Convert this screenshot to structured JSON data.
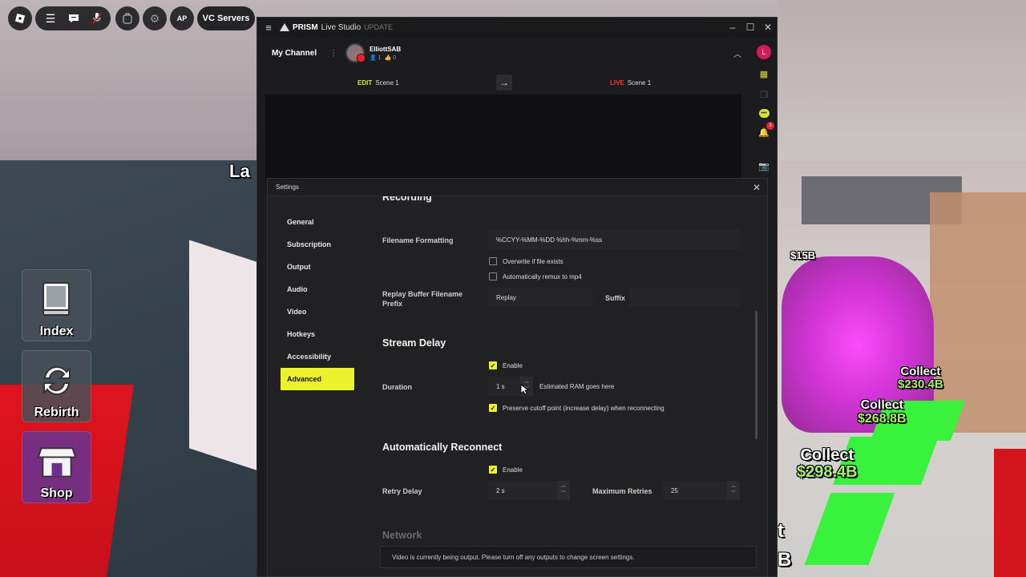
{
  "game": {
    "toolbar": {
      "vc_servers": "VC Servers"
    },
    "side_buttons": {
      "index": "Index",
      "rebirth": "Rebirth",
      "shop": "Shop"
    },
    "world_text": {
      "wall_partial": "La",
      "price_tag": "$15B",
      "collect_1": {
        "label": "Collect",
        "amount": "$230.4B"
      },
      "collect_2": {
        "label": "Collect",
        "amount": "$268.8B"
      },
      "collect_3": {
        "label": "Collect",
        "amount": "$298.4B"
      },
      "edge_t": "t",
      "edge_b": "B"
    }
  },
  "prism": {
    "app_name": "PRISM",
    "app_sub": "Live Studio",
    "update_badge": "UPDATE",
    "my_channel": "My Channel",
    "user": {
      "name": "ElliottSAB",
      "viewers": "1",
      "likes": "0"
    },
    "scene": {
      "edit_tag": "EDIT",
      "edit_scene": "Scene 1",
      "live_tag": "LIVE",
      "live_scene": "Scene 1"
    },
    "profile_initial": "L",
    "notification_count": "3"
  },
  "settings": {
    "title": "Settings",
    "nav": [
      "General",
      "Subscription",
      "Output",
      "Audio",
      "Video",
      "Hotkeys",
      "Accessibility",
      "Advanced"
    ],
    "active_nav": "Advanced",
    "recording": {
      "heading": "Recording",
      "filename_label": "Filename Formatting",
      "filename_value": "%CCYY-%MM-%DD %hh-%mm-%ss",
      "overwrite_label": "Overwrite if file exists",
      "overwrite_checked": false,
      "remux_label": "Automatically remux to mp4",
      "remux_checked": false,
      "replay_label": "Replay Buffer Filename Prefix",
      "replay_value": "Replay",
      "suffix_label": "Suffix",
      "suffix_value": ""
    },
    "stream_delay": {
      "heading": "Stream Delay",
      "enable_label": "Enable",
      "enable_checked": true,
      "duration_label": "Duration",
      "duration_value": "1 s",
      "ram_note": "Estimated RAM goes here",
      "preserve_label": "Preserve cutoff point (increase delay) when reconnecting",
      "preserve_checked": true
    },
    "reconnect": {
      "heading": "Automatically Reconnect",
      "enable_label": "Enable",
      "enable_checked": true,
      "retry_label": "Retry Delay",
      "retry_value": "2 s",
      "max_label": "Maximum Retries",
      "max_value": "25"
    },
    "network": {
      "heading": "Network"
    },
    "notice": "Video is currently being output. Please turn off any outputs to change screen settings."
  }
}
